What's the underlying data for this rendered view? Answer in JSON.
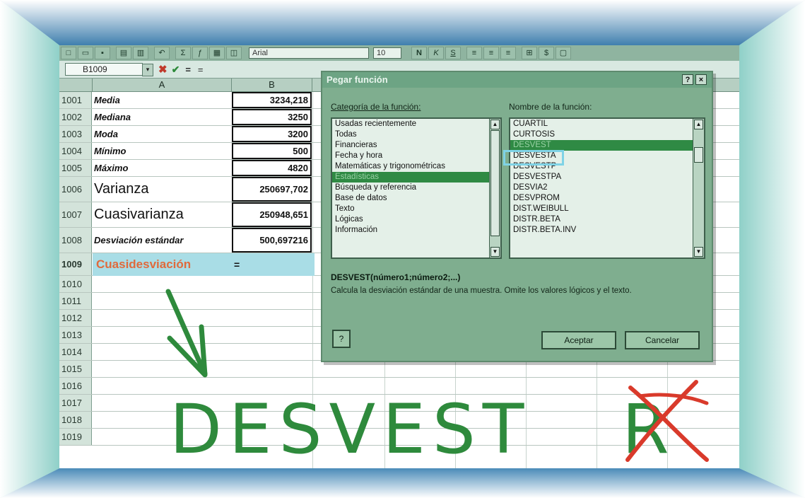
{
  "formula_bar": {
    "name_box": "B1009",
    "name_box_arrow": "▾",
    "cancel": "✖",
    "enter": "✔",
    "equals": "=",
    "content": "="
  },
  "toolbar": {
    "icons": [
      "new-icon",
      "open-icon",
      "save-icon",
      "print-icon",
      "preview-icon",
      "undo-icon",
      "sum-icon",
      "function-icon",
      "chart-icon",
      "zoom-icon"
    ],
    "font": "Arial",
    "size": "10"
  },
  "columns": {
    "a": "A",
    "b": "B"
  },
  "rows": [
    {
      "num": "1001",
      "label": "Media",
      "value": "3234,218",
      "big": false
    },
    {
      "num": "1002",
      "label": "Mediana",
      "value": "3250",
      "big": false
    },
    {
      "num": "1003",
      "label": "Moda",
      "value": "3200",
      "big": false
    },
    {
      "num": "1004",
      "label": "Mínimo",
      "value": "500",
      "big": false
    },
    {
      "num": "1005",
      "label": "Máximo",
      "value": "4820",
      "big": false
    },
    {
      "num": "1006",
      "label": "Varianza",
      "value": "250697,702",
      "big": true
    },
    {
      "num": "1007",
      "label": "Cuasivarianza",
      "value": "250948,651",
      "big": true
    },
    {
      "num": "1008",
      "label": "Desviación estándar",
      "value": "500,697216",
      "big": false
    }
  ],
  "active_row": {
    "num": "1009",
    "label": "Cuasidesviación",
    "value": "="
  },
  "empty_rows": [
    "1010",
    "1011",
    "1012",
    "1013",
    "1014",
    "1015",
    "1016",
    "1017",
    "1018",
    "1019"
  ],
  "dialog": {
    "title": "Pegar función",
    "help_btn": "?",
    "close_btn": "×",
    "category_label": "Categoría de la función:",
    "categories": [
      "Usadas recientemente",
      "Todas",
      "Financieras",
      "Fecha y hora",
      "Matemáticas y trigonométricas",
      "Estadísticas",
      "Búsqueda y referencia",
      "Base de datos",
      "Texto",
      "Lógicas",
      "Información"
    ],
    "selected_category": 5,
    "function_label": "Nombre de la función:",
    "functions": [
      "CUARTIL",
      "CURTOSIS",
      "DESVEST",
      "DESVESTA",
      "DESVESTP",
      "DESVESTPA",
      "DESVIA2",
      "DESVPROM",
      "DIST.WEIBULL",
      "DISTR.BETA",
      "DISTR.BETA.INV"
    ],
    "selected_function": 2,
    "syntax": "DESVEST(número1;número2;...)",
    "description": "Calcula la desviación estándar de una muestra. Omite los valores lógicos y el texto.",
    "office_assistant": "?",
    "ok": "Aceptar",
    "cancel": "Cancelar"
  },
  "annotation": {
    "text": "DESVEST",
    "crossed_letter": "R",
    "ink_color": "#2e8a3c",
    "cross_color": "#d93a2b"
  }
}
